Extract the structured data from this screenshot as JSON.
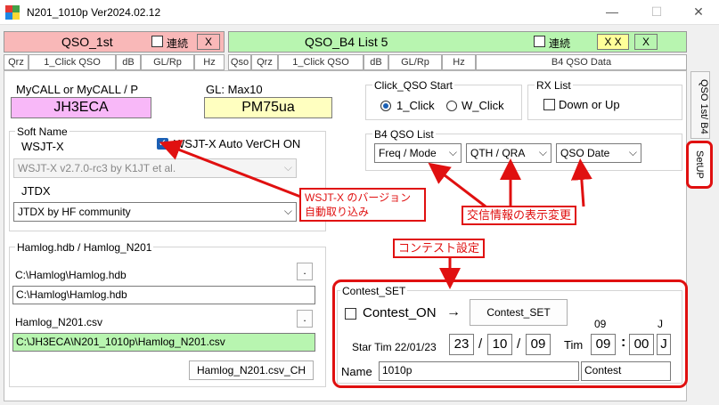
{
  "window": {
    "title": "N201_1010p   Ver2024.02.12",
    "controls": {
      "minimize": "—",
      "maximize": "☐",
      "close": "✕"
    }
  },
  "qso_1st": {
    "title": "QSO_1st",
    "renzoku_label": "連続",
    "clear_label": "X"
  },
  "qso_b4": {
    "title": "QSO_B4   List  5",
    "renzoku_label": "連続",
    "xx_label": "X X",
    "clear_label": "X"
  },
  "tabs": [
    "Qrz",
    "1_Click QSO",
    "dB",
    "GL/Rp",
    "Hz",
    "Qso",
    "Qrz",
    "1_Click QSO",
    "dB",
    "GL/Rp",
    "Hz",
    "B4 QSO Data"
  ],
  "side_tabs": {
    "tab1": "QSO 1st/ B4",
    "tab2": "SetUP"
  },
  "mycall": {
    "label": "MyCALL  or  MyCALL / P",
    "value": "JH3ECA"
  },
  "gl": {
    "label": "GL:  Max10",
    "value": "PM75ua"
  },
  "click_qso": {
    "title": "Click_QSO Start",
    "opt1": "1_Click",
    "opt2": "W_Click",
    "selected": "1_Click"
  },
  "rx_list": {
    "title": "RX List",
    "opt": "Down or Up"
  },
  "b4_list": {
    "title": "B4 QSO List",
    "combo1": "Freq / Mode",
    "combo2": "QTH / QRA",
    "combo3": "QSO Date"
  },
  "soft": {
    "group_label": "Soft Name",
    "wsjtx_label": "WSJT-X",
    "auto_label": "WSJT-X  Auto  VerCH   ON",
    "wsjtx_value": "WSJT-X   v2.7.0-rc3   by K1JT et al.",
    "jtdx_label": "JTDX",
    "jtdx_value": "JTDX  by HF community"
  },
  "hamlog": {
    "group_label": "Hamlog.hdb / Hamlog_N201",
    "hdb_label": "C:\\Hamlog\\Hamlog.hdb",
    "hdb_value": "C:\\Hamlog\\Hamlog.hdb",
    "browse": ".",
    "n201_label": "Hamlog_N201.csv",
    "n201_value": "C:\\JH3ECA\\N201_1010p\\Hamlog_N201.csv",
    "ch_button": "Hamlog_N201.csv_CH"
  },
  "contest": {
    "group_label": "Contest_SET",
    "on_label": "Contest_ON",
    "arrow": "→",
    "set_button": "Contest_SET",
    "hour_hint": "09",
    "j_hint": "J",
    "start_label": "Star Tim 22/01/23",
    "day": "23",
    "sep1": "/",
    "month": "10",
    "sep2": "/",
    "year": "09",
    "tim_label": "Tim",
    "hour": "09",
    "colon": ":",
    "minute": "00",
    "tz": "J",
    "name_label": "Name",
    "name_value": "1010p",
    "type_value": "Contest"
  },
  "annotations": {
    "version": "WSJT-X のバージョン\n自動取り込み",
    "display": "交信情報の表示変更",
    "contest": "コンテスト設定"
  },
  "colors": {
    "pink_panel": "#f9b8b8",
    "green_panel": "#b8f5b0",
    "mycall_bg": "#f8b8f8",
    "gl_bg": "#ffffc0",
    "n201_bg": "#b8f5b0",
    "annotation_red": "#e01010"
  }
}
